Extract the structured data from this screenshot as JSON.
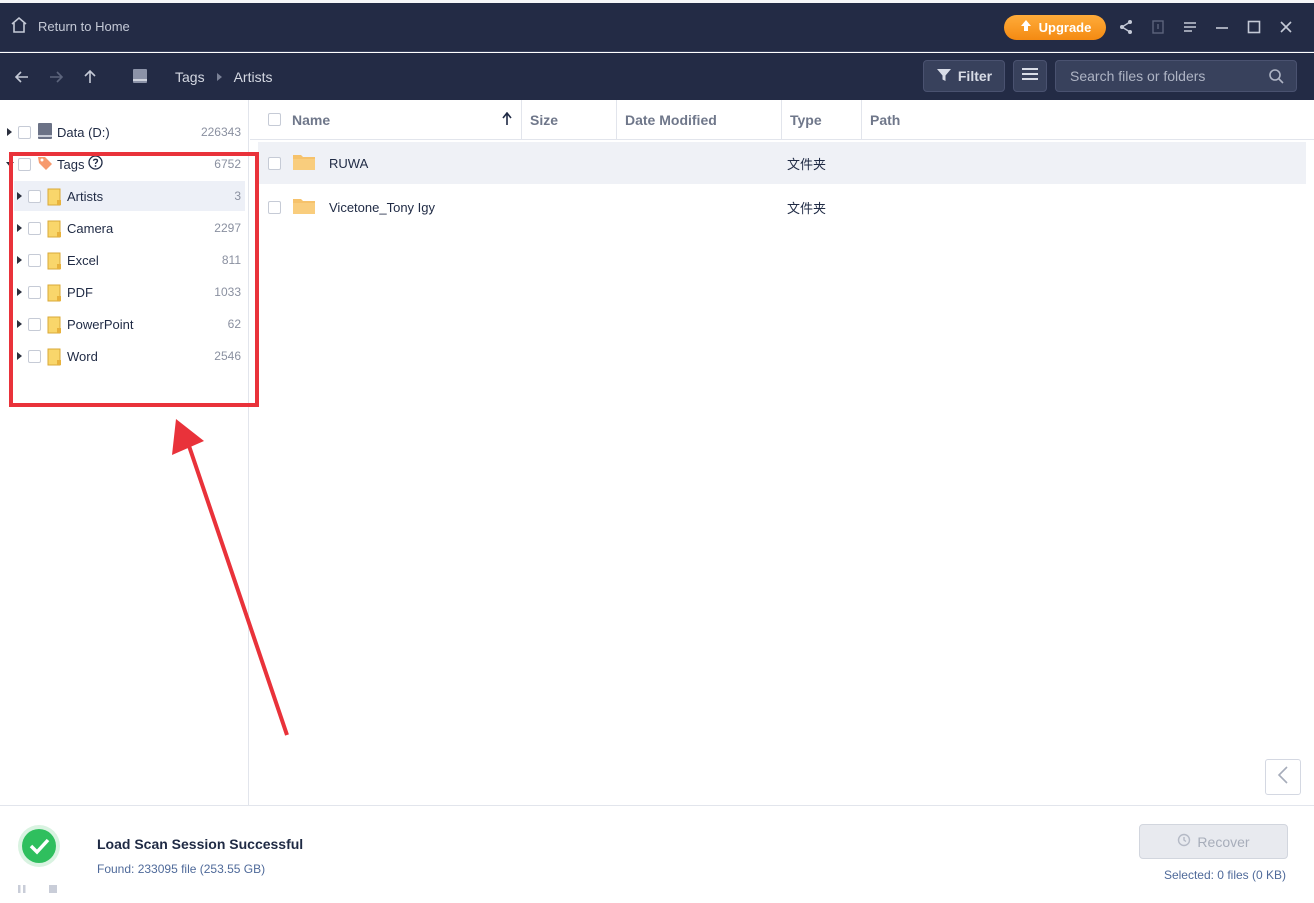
{
  "titlebar": {
    "home_label": "Return to Home",
    "upgrade_label": "Upgrade"
  },
  "nav": {
    "breadcrumbs": [
      "Tags",
      "Artists"
    ],
    "filter_label": "Filter",
    "search_placeholder": "Search files or folders"
  },
  "tree": {
    "root": {
      "label": "Data (D:)",
      "count": "226343"
    },
    "tags": {
      "label": "Tags",
      "count": "6752"
    },
    "items": [
      {
        "label": "Artists",
        "count": "3"
      },
      {
        "label": "Camera",
        "count": "2297"
      },
      {
        "label": "Excel",
        "count": "811"
      },
      {
        "label": "PDF",
        "count": "1033"
      },
      {
        "label": "PowerPoint",
        "count": "62"
      },
      {
        "label": "Word",
        "count": "2546"
      }
    ]
  },
  "list": {
    "columns": {
      "name": "Name",
      "size": "Size",
      "date": "Date Modified",
      "type": "Type",
      "path": "Path"
    },
    "rows": [
      {
        "name": "RUWA",
        "type": "文件夹"
      },
      {
        "name": "Vicetone_Tony Igy",
        "type": "文件夹"
      }
    ]
  },
  "status": {
    "title": "Load Scan Session Successful",
    "found": "Found: 233095 file (253.55 GB)",
    "recover_label": "Recover",
    "selected": "Selected: 0 files (0 KB)"
  },
  "colors": {
    "header_bg": "#232b45",
    "upgrade": "#f48a12",
    "highlight": "#e9323a",
    "success": "#2fbf5e",
    "folder": "#f6c26b"
  }
}
